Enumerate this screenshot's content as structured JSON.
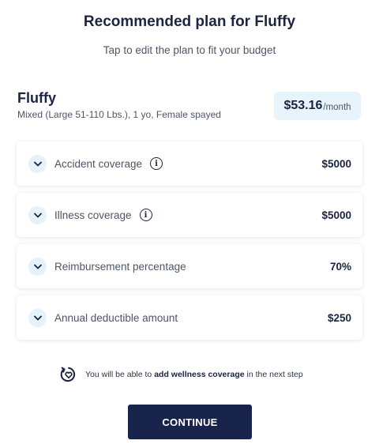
{
  "header": {
    "title": "Recommended plan for Fluffy",
    "subtitle": "Tap to edit the plan to fit your budget"
  },
  "pet": {
    "name": "Fluffy",
    "details": "Mixed (Large 51-110 Lbs.), 1 yo, Female spayed"
  },
  "price": {
    "amount": "$53.16",
    "unit": "/month"
  },
  "coverage": [
    {
      "label": "Accident coverage",
      "value": "$5000",
      "info_icon": true
    },
    {
      "label": "Illness coverage",
      "value": "$5000",
      "info_icon": true
    },
    {
      "label": "Reimbursement percentage",
      "value": "70%",
      "info_icon": false
    },
    {
      "label": "Annual deductible amount",
      "value": "$250",
      "info_icon": false
    }
  ],
  "icons": {
    "expand": "chevron-down-icon",
    "info": "info-icon",
    "wellness": "heart-refresh-icon",
    "info_glyph": "i"
  },
  "note": {
    "prefix": "You will be able to ",
    "emphasis": "add wellness coverage",
    "suffix": " in the next step"
  },
  "actions": {
    "continue_label": "CONTINUE"
  },
  "colors": {
    "primary": "#18244b",
    "accent_bg": "#e8f4fb",
    "text_muted": "#4d5566"
  }
}
